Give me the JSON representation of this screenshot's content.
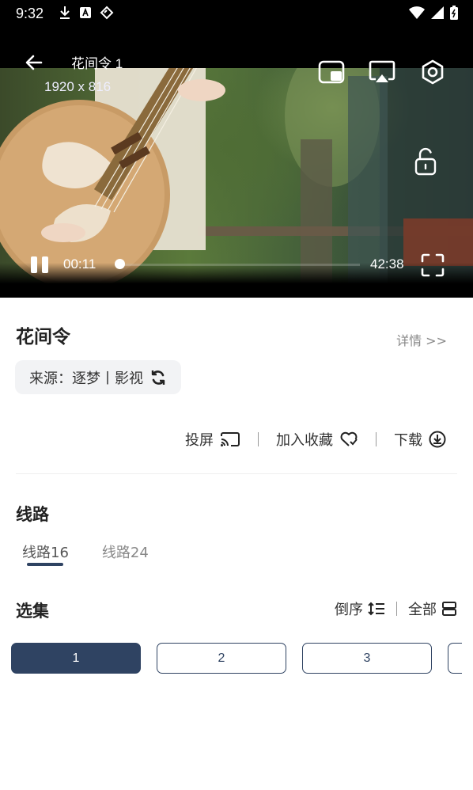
{
  "status_bar": {
    "time": "9:32",
    "left_icons": [
      "download-icon",
      "font-icon",
      "tag-icon"
    ],
    "right_icons": [
      "wifi-icon",
      "signal-icon",
      "battery-icon"
    ]
  },
  "player": {
    "title": "花间令 1",
    "resolution": "1920 x 816",
    "current_time": "00:11",
    "total_time": "42:38",
    "progress": 0.004,
    "top_icons": [
      "pip-icon",
      "airplay-icon",
      "settings-icon"
    ]
  },
  "details": {
    "title": "花间令",
    "detail_link": "详情 >>",
    "source_label": "来源：逐梦丨影视"
  },
  "actions": {
    "cast": "投屏",
    "favorite": "加入收藏",
    "download": "下载"
  },
  "routes": {
    "section_title": "线路",
    "tabs": [
      {
        "label": "线路16",
        "active": true
      },
      {
        "label": "线路24",
        "active": false
      }
    ]
  },
  "episodes": {
    "section_title": "选集",
    "sort_label": "倒序",
    "all_label": "全部",
    "items": [
      "1",
      "2",
      "3",
      ""
    ],
    "active_index": 0
  },
  "colors": {
    "accent": "#2f4362",
    "muted_text": "#888888",
    "chip_bg": "#f2f3f5"
  }
}
